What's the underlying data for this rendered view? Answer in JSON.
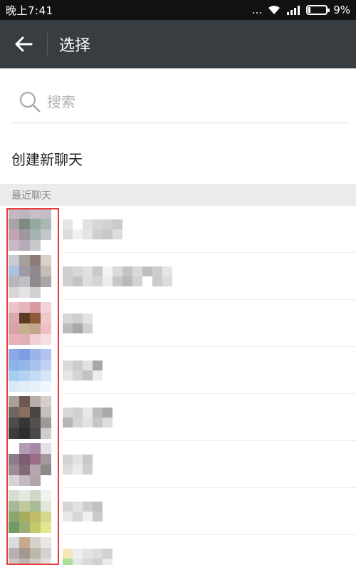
{
  "status_bar": {
    "time": "晚上7:41",
    "dots": "...",
    "battery": "9%"
  },
  "header": {
    "title": "选择",
    "back_icon": "arrow-left-icon"
  },
  "search": {
    "placeholder": "搜索",
    "icon": "search-icon"
  },
  "new_chat_label": "创建新聊天",
  "recent_section_label": "最近聊天",
  "colors": {
    "app_bar": "#383d41",
    "status_bar": "#111111",
    "highlight": "#e53b3b",
    "section_bg": "#ebebeb"
  },
  "chat_rows": [
    {
      "avatar": [
        "#c6b8c2",
        "#bdb6bf",
        "#c7c0c8",
        "#c5bdc6",
        "#a9a2a8",
        "#7e8a84",
        "#94aaa0",
        "#aab7b4",
        "#c2a4b4",
        "#9f98a1",
        "#a6b4b3",
        "#c1c8c8",
        "#c9b8c6",
        "#b7adb8",
        "#c5c9cc",
        "#ffffff"
      ],
      "name_pixels": [
        "#e6e6e6",
        "#ffffff",
        "#e1e1e1",
        "#d6d6d6",
        "#d1d1d1",
        "#cacaca",
        "#dcdcdc",
        "#f0f0f0",
        "#e4e4e4",
        "#cfcfcf",
        "#c8c8c8",
        "#dddddd"
      ]
    },
    {
      "avatar": [
        "#c7cbd6",
        "#a69e9a",
        "#8b7c78",
        "#d8d1ca",
        "#aac1e0",
        "#9e9aa4",
        "#8c8a8c",
        "#c7bdb8",
        "#b5b5bb",
        "#bfbfc4",
        "#8e8a8d",
        "#a9a6a9",
        "#d6d6d8",
        "#e3e3e5",
        "#d1d1d3",
        "#ffffff"
      ],
      "name_pixels": [
        "#cfcfcf",
        "#d6d6d6",
        "#e0e0e0",
        "#c9c9c9",
        "#f2f2f2",
        "#dadada",
        "#c4c4c4",
        "#d9d9d9",
        "#bebebe",
        "#cdcdcd",
        "#e5e5e5",
        "#d0d0d0",
        "#c3c3c3",
        "#dedede",
        "#d5d5d5",
        "#ececec",
        "#c8c8c8",
        "#b9b9b9",
        "#d2d2d2",
        "#ffffff",
        "#cbcbcb",
        "#dcdcdc"
      ]
    },
    {
      "avatar": [
        "#ecc3c8",
        "#e6b5bb",
        "#d99aa3",
        "#f2d3d7",
        "#d9a9ad",
        "#5c3b22",
        "#8c5a36",
        "#f0c8cc",
        "#d7a3a9",
        "#c7b08c",
        "#c3a58e",
        "#eec0c6",
        "#e6b1b8",
        "#e4aeb5",
        "#f1d0d4",
        "#f6dfe1"
      ],
      "name_pixels": [
        "#d6d6d6",
        "#cfcfcf",
        "#e2e2e2",
        "#bcbcbc",
        "#a8a8a8",
        "#d0d0d0"
      ]
    },
    {
      "avatar": [
        "#8aa7e6",
        "#7d9de3",
        "#9bb3ea",
        "#b1c3ee",
        "#8ab3e8",
        "#94b7ea",
        "#a6c1ee",
        "#c1d2f2",
        "#a9cdf0",
        "#b6d2f2",
        "#c4dbf4",
        "#d6e5f7",
        "#d9e9f8",
        "#e1edf9",
        "#e8f1fa",
        "#f0f6fc"
      ],
      "name_pixels": [
        "#d9d9d9",
        "#cccccc",
        "#e1e1e1",
        "#a7a7a7",
        "#e6e6e6",
        "#d3d3d3",
        "#c2c2c2",
        "#ececec"
      ]
    },
    {
      "avatar": [
        "#a9a09a",
        "#6c5a50",
        "#b8aca6",
        "#d4cfcd",
        "#6e6661",
        "#8a6f5f",
        "#4a4440",
        "#c5c0bd",
        "#4d4b4b",
        "#393636",
        "#555050",
        "#9e9a98",
        "#3c3b3b",
        "#2f2d2d",
        "#4a4848",
        "#cfcdcc"
      ],
      "name_pixels": [
        "#d8d8d8",
        "#cfcfcf",
        "#e8e8e8",
        "#bcbcbc",
        "#a9a9a9",
        "#b6b6b6",
        "#d4d4d4",
        "#e2e2e2",
        "#c6c6c6",
        "#dddddd"
      ]
    },
    {
      "avatar": [
        "#ffffff",
        "#b49ab3",
        "#a889a7",
        "#e4e0e6",
        "#8e7c8e",
        "#7c5e73",
        "#9d6c86",
        "#a4999f",
        "#9c8a96",
        "#7e6b76",
        "#b6a4ae",
        "#8c8888",
        "#d7d4d7",
        "#c4b9c0",
        "#b0a5ab",
        "#ffffff"
      ],
      "name_pixels": [
        "#d2d2d2",
        "#e3e3e3",
        "#c8c8c8",
        "#dcdcdc",
        "#ececec",
        "#cfcfcf"
      ]
    },
    {
      "avatar": [
        "#d7ddd2",
        "#e4e9df",
        "#d0d8c9",
        "#f1f3ee",
        "#a4b99c",
        "#c2c89c",
        "#a9bc95",
        "#e2e7dc",
        "#8ba56f",
        "#a6ad60",
        "#bfbc6c",
        "#d5d88c",
        "#6e9c63",
        "#9bac74",
        "#c4c96a",
        "#e3e58f"
      ],
      "name_pixels": [
        "#d4d4d4",
        "#e1e1e1",
        "#cdcdcd",
        "#c1c1c1",
        "#e8e8e8",
        "#d7d7d7",
        "#f0f0f0",
        "#cacaca"
      ]
    },
    {
      "avatar": [
        "#d8dbe1",
        "#c7a88c",
        "#d6d0ca",
        "#e9e6e3",
        "#b8b0b2",
        "#a5998f",
        "#bfb6ae",
        "#d5d1cf",
        "#cbc6c3",
        "#bcb7b3",
        "#d0cbc7",
        "#e3e0de",
        "#ffffff",
        "#ffffff",
        "#ffffff",
        "#ffffff"
      ],
      "name_pixels": [
        "#f5e6b8",
        "#eeeeee",
        "#e3e3e3",
        "#dcdcdc",
        "#d2d2d2",
        "#a8e09b",
        "#e6e6e6",
        "#dadada",
        "#cfcfcf",
        "#eaeaea"
      ]
    }
  ]
}
